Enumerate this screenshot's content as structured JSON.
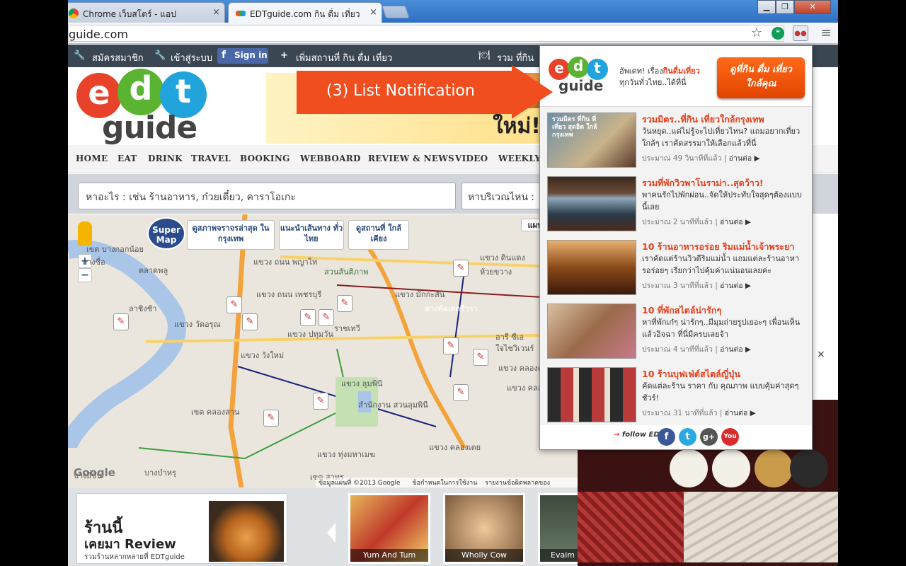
{
  "browser": {
    "tabs": [
      {
        "label": "Chrome เว็บสโตร์ - แอป",
        "close": "×"
      },
      {
        "label": "EDTguide.com กิน ดื่ม เที่ยว",
        "close": "×"
      }
    ],
    "address": "guide.com",
    "window_buttons": [
      "▁",
      "❐",
      "✕"
    ]
  },
  "site": {
    "topnav": {
      "register": "สมัครสมาชิก",
      "login": "เข้าสู่ระบบ",
      "fb_signin": "Sign in",
      "add_place": "เพิ่มสถานที่ กิน ดื่ม เที่ยว",
      "collect": "รวม ที่กิน"
    },
    "logo": {
      "e": "e",
      "d": "d",
      "t": "t",
      "eat": "eat",
      "drink": "drink",
      "travel": "travel",
      "guide": "guide"
    },
    "banner_text": "ใหม่!",
    "menu": [
      "HOME",
      "EAT",
      "DRINK",
      "TRAVEL",
      "BOOKING",
      "WEBBOARD",
      "REVIEW & NEWS",
      "VIDEO",
      "WEEKLY"
    ],
    "search": {
      "what_placeholder": "หาอะไร : เช่น ร้านอาหาร, ก๋วยเตี๋ยว, คาราโอเกะ",
      "where_placeholder": "หาบริเวณไหน :"
    },
    "map": {
      "supermap": "Super Map",
      "buttons": [
        "ดูสภาพจราจรล่าสุด ในกรุงเทพ",
        "แนะนำเส้นทาง ทั่วไทย",
        "ดูสถานที่ ใกล้เคียง"
      ],
      "zoom_in": "+",
      "zoom_out": "−",
      "view_toggle": "แผน",
      "google": "Google",
      "footer": "ข้อมูลแผนที่ ©2013 Google",
      "terms": "ข้อกำหนดในการใช้งาน",
      "report": "รายงานข้อผิดพลาดของ",
      "labels": [
        "แขวง ดินแดง",
        "ห้วยขวาง",
        "สวนสันติภาพ",
        "แขวง ถนน พญาไท",
        "แขวง ถนน เพชรบุรี",
        "แขวง มักกะสัน",
        "หางพัฒคตรีวรา",
        "ราชเทวี",
        "แขวง วังใหม่",
        "แขวง ลุมพินี",
        "สำนักงาน สวนลุมพินี",
        "เขต คลองสาน",
        "แขวง คลองเตย",
        "แขวง ทุ่งมหาเมฆ",
        "เขต สาทร",
        "บางซื่อ",
        "ลาชิงช้า",
        "แขวง คลองต้น",
        "แขวง คลองตัน",
        "อารี ซีเอ",
        "ใจไชวิเวนร์",
        "เขต บางกอกน้อย",
        "ตลาดพลู",
        "แขวง วัดอรุณ",
        "บางยี่ขัน",
        "บางบำหรุ",
        "แขวง ปทุมวัน"
      ]
    },
    "strip": {
      "promo_title": "ร้านนี้",
      "promo_review": "เคยมา Review",
      "promo_sub": "รวมร้านหลากหลายที่ EDTguide",
      "thumbs": [
        "Yum And Tum",
        "Wholly Cow",
        "Evaim"
      ]
    }
  },
  "popup": {
    "tagline_1": "อัพเดท! เรื่อง",
    "tagline_hl": "กินดื่มเที่ยว",
    "tagline_2": "ทุกวันทั่วไทย..ได้ที่นี่",
    "cta_1": "ดูที่กิน ดื่ม เที่ยว",
    "cta_2": "ใกล้คุณ",
    "items": [
      {
        "title": "รวมมิตร..ที่กิน เที่ยวใกล้กรุงเทพ",
        "desc": "วันหยุด..แต่ไม่รู้จะไปเที่ยวไหน? แถมอยากเที่ยวใกล้ๆ เราคัดสรรมาให้เลือกแล้วที่นี่",
        "time": "ประมาณ 49 วินาทีที่แล้ว",
        "read": "อ่านต่อ ▶",
        "img_text": "รวมมิตร ที่กิน ที่เที่ยว สุดฮิต ใกล้กรุงเทพ"
      },
      {
        "title": "รวมที่พักวิวพาโนราม่า..สุดว้าว!",
        "desc": "พาคนรักไปพักผ่อน..จัดให้ประทับใจสุดๆต้องแบบนี้เลย",
        "time": "ประมาณ 2 นาทีที่แล้ว",
        "read": "อ่านต่อ ▶",
        "img_text": ""
      },
      {
        "title": "10 ร้านอาหารอร่อย ริมแม่น้ำเจ้าพระยา",
        "desc": "เราคัดแต่ร้านวิวดีริมแม่น้ำ แถมแต่ละร้านอาหารอร่อยๆ เรียกว่าไปคุ้มค่าแน่นอนเลยค่ะ",
        "time": "ประมาณ 3 นาทีที่แล้ว",
        "read": "อ่านต่อ ▶",
        "img_text": ""
      },
      {
        "title": "10 ที่พักสไตล์น่ารักๆ",
        "desc": "หาที่พักเก๋ๆ น่ารักๆ..มีมุมถ่ายรูปเยอะๆ เพื่อนเห็นแล้วอิจฉา ที่นี่มีครบเลยจ้า",
        "time": "ประมาณ 4 นาทีที่แล้ว",
        "read": "อ่านต่อ ▶",
        "img_text": ""
      },
      {
        "title": "10 ร้านบุฟเฟ่ต์สไตล์ญี่ปุ่น",
        "desc": "คัดแต่ละร้าน ราคา กับ คุณภาพ แบบคุ้มค่าสุดๆ ชัวร์!",
        "time": "ประมาณ 31 นาทีที่แล้ว",
        "read": "อ่านต่อ ▶",
        "img_text": ""
      }
    ],
    "follow": "follow EDT",
    "social": [
      "f",
      "t",
      "g+",
      "You"
    ]
  },
  "annotation": {
    "text": "(3) List Notification"
  },
  "right_close": "×",
  "colors": {
    "accent_orange": "#f04e1f",
    "title_red": "#e4401d",
    "nav_dark": "#3b4653",
    "fb_blue": "#3b5998"
  }
}
